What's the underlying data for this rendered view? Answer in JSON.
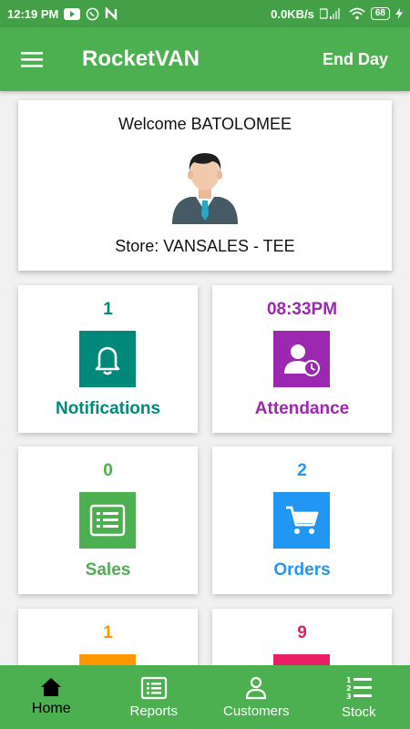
{
  "status_bar": {
    "time": "12:19 PM",
    "speed": "0.0KB/s",
    "battery": "68"
  },
  "app_bar": {
    "title": "RocketVAN",
    "end_day_label": "End Day"
  },
  "welcome": {
    "greeting": "Welcome BATOLOMEE",
    "store": "Store: VANSALES - TEE"
  },
  "tiles": [
    {
      "count": "1",
      "label": "Notifications",
      "color": "#00897b",
      "icon": "bell-icon"
    },
    {
      "count": "08:33PM",
      "label": "Attendance",
      "color": "#9c27b0",
      "icon": "user-clock-icon"
    },
    {
      "count": "0",
      "label": "Sales",
      "color": "#4caf50",
      "icon": "list-doc-icon"
    },
    {
      "count": "2",
      "label": "Orders",
      "color": "#2196f3",
      "icon": "cart-icon"
    },
    {
      "count": "1",
      "label": "",
      "color": "#ff9800",
      "icon": "tile-icon"
    },
    {
      "count": "9",
      "label": "",
      "color": "#e91e63",
      "icon": "tile-icon"
    }
  ],
  "bottom_nav": [
    {
      "label": "Home",
      "icon": "home-icon",
      "active": true
    },
    {
      "label": "Reports",
      "icon": "report-icon",
      "active": false
    },
    {
      "label": "Customers",
      "icon": "person-icon",
      "active": false
    },
    {
      "label": "Stock",
      "icon": "numbered-list-icon",
      "active": false
    }
  ]
}
